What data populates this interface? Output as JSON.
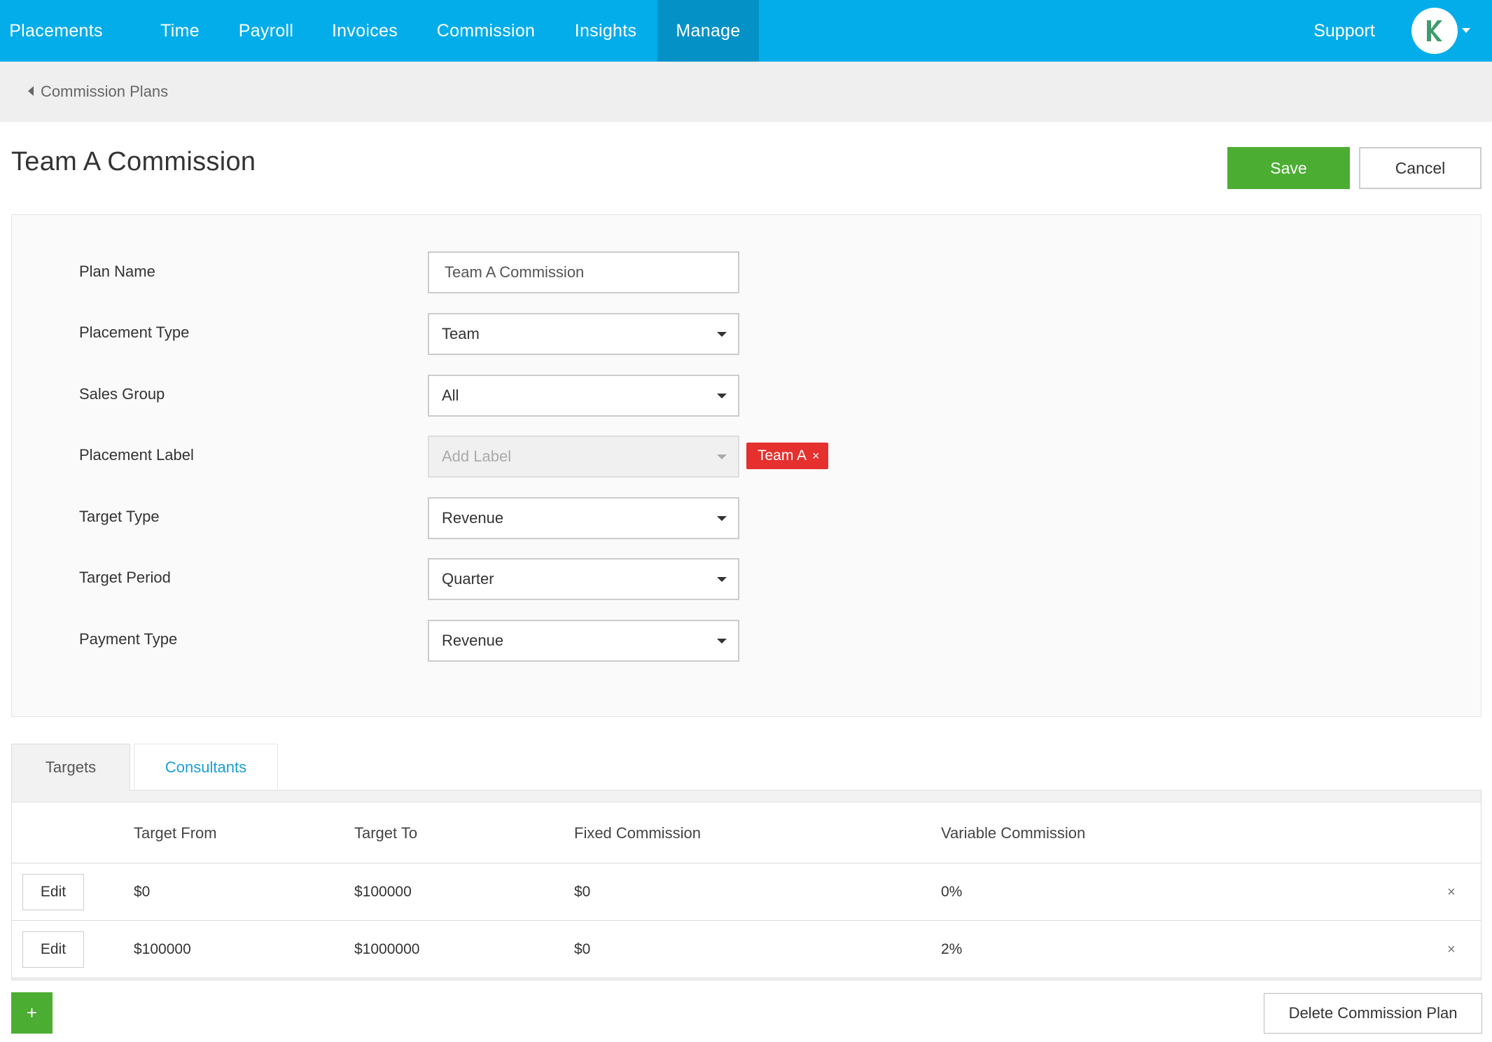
{
  "nav": {
    "items": [
      {
        "label": "Placements"
      },
      {
        "label": "Time"
      },
      {
        "label": "Payroll"
      },
      {
        "label": "Invoices"
      },
      {
        "label": "Commission"
      },
      {
        "label": "Insights"
      },
      {
        "label": "Manage",
        "active": true
      }
    ],
    "support": "Support",
    "avatar_icon": "kh-logo-icon",
    "colors": {
      "bar": "#02ade9",
      "active": "#0391c6",
      "avatar_logo": "#3f9a6e"
    }
  },
  "breadcrumb": {
    "label": "Commission Plans"
  },
  "header": {
    "title": "Team A Commission",
    "save_label": "Save",
    "cancel_label": "Cancel"
  },
  "form": {
    "plan_name": {
      "label": "Plan Name",
      "value": "Team A Commission"
    },
    "placement_type": {
      "label": "Placement Type",
      "value": "Team"
    },
    "sales_group": {
      "label": "Sales Group",
      "value": "All"
    },
    "placement_label": {
      "label": "Placement Label",
      "placeholder": "Add Label",
      "tags": [
        "Team A"
      ],
      "tag_remove": "×"
    },
    "target_type": {
      "label": "Target Type",
      "value": "Revenue"
    },
    "target_period": {
      "label": "Target Period",
      "value": "Quarter"
    },
    "payment_type": {
      "label": "Payment Type",
      "value": "Revenue"
    }
  },
  "tabs": [
    {
      "label": "Targets",
      "active": true
    },
    {
      "label": "Consultants"
    }
  ],
  "table": {
    "columns": [
      "Target From",
      "Target To",
      "Fixed Commission",
      "Variable Commission"
    ],
    "rows": [
      {
        "edit": "Edit",
        "from": "$0",
        "to": "$100000",
        "fixed": "$0",
        "variable": "0%",
        "remove": "×"
      },
      {
        "edit": "Edit",
        "from": "$100000",
        "to": "$1000000",
        "fixed": "$0",
        "variable": "2%",
        "remove": "×"
      }
    ]
  },
  "footer": {
    "add_label": "+",
    "delete_label": "Delete Commission Plan"
  },
  "colors": {
    "green": "#4cad33",
    "tag_red": "#e5302e",
    "link_blue": "#1a9ed8"
  }
}
